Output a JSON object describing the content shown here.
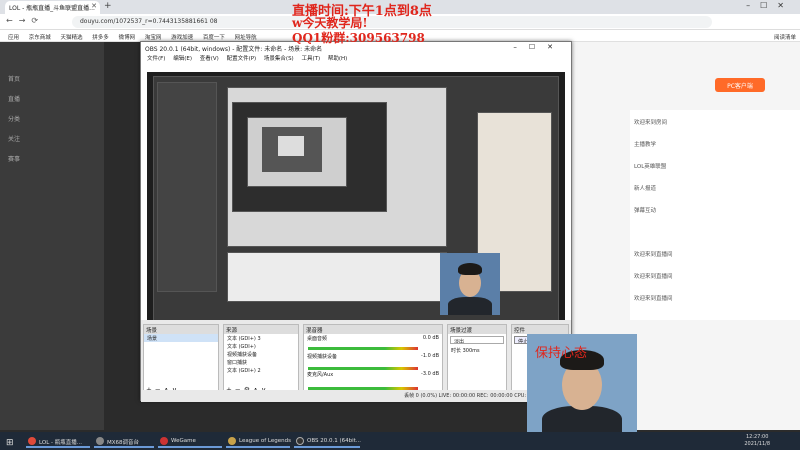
{
  "browser": {
    "tab_title": "LOL - 瓶瓶直播_斗鱼联盟直播...",
    "url": "douyu.com/1072537_r=0.7443135881661 08",
    "bookmarks": [
      "应用",
      "京东商城",
      "天猫精选",
      "拼多多",
      "微博网",
      "淘宝网",
      "游戏加速",
      "百度一下",
      "网址导航"
    ],
    "reading_list": "阅读清单"
  },
  "douyu": {
    "pc_button": "PC客户端",
    "sidebar": [
      "首页",
      "直播",
      "分类",
      "关注",
      "赛事"
    ],
    "chat": [
      "欢迎来到房间",
      "主播教学",
      "LOL英雄联盟",
      "新人报道",
      "弹幕互动",
      "欢迎来到直播间",
      "欢迎来到直播间",
      "欢迎来到直播间"
    ]
  },
  "overlay": {
    "line1": "直播时间:下午1点到8点",
    "line2": "w今天教学局!",
    "line3": "QQ1粉群:309563798",
    "cam_text": "保持心态"
  },
  "obs": {
    "title": "OBS 20.0.1 (64bit, windows) - 配置文件: 未命名 - 场景: 未命名",
    "menu": [
      "文件(F)",
      "编辑(E)",
      "查看(V)",
      "配置文件(P)",
      "场景集合(S)",
      "工具(T)",
      "帮助(H)"
    ],
    "docks": {
      "scenes": {
        "title": "场景",
        "items": [
          "场景"
        ]
      },
      "sources": {
        "title": "来源",
        "items": [
          "文本 (GDI+) 3",
          "文本 (GDI+)",
          "视频捕获设备",
          "窗口捕获",
          "文本 (GDI+) 2"
        ]
      },
      "mixer": {
        "title": "混音器",
        "items": [
          "桌面音频",
          "视频捕获设备",
          "麦克风/Aux"
        ],
        "levels": [
          "0.0 dB",
          "-1.0 dB",
          "-3.0 dB"
        ]
      },
      "transitions": {
        "title": "场景过渡",
        "type": "淡出",
        "duration_label": "时长",
        "duration": "300ms"
      },
      "controls": {
        "title": "控件",
        "start": "停止推流"
      }
    },
    "status": "丢帧 0 (0.0%)   LIVE: 00:00:00   REC: 00:00:00   CPU: 1.6%, 60.00 fps"
  },
  "taskbar": {
    "items": [
      "LOL - 瓶瓶直播...",
      "MX68调音台",
      "WeGame",
      "League of Legends",
      "OBS 20.0.1 (64bit..."
    ],
    "time": "12:27:00",
    "date": "2021/11/8"
  }
}
